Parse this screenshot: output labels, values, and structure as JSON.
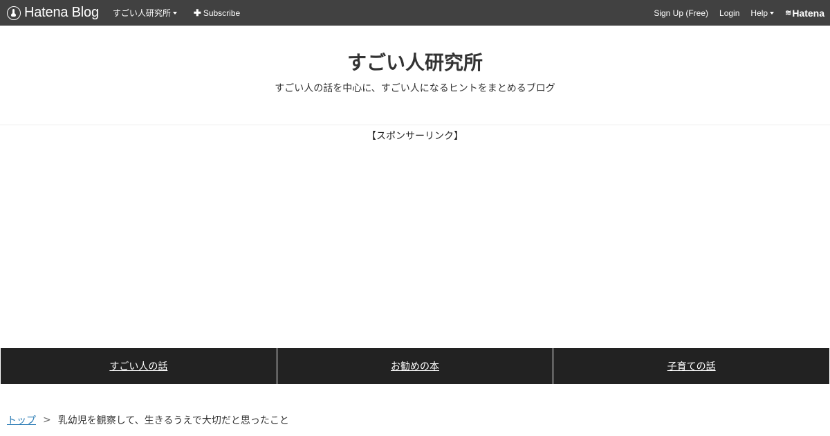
{
  "topbar": {
    "logo_text": "Hatena Blog",
    "blog_menu": "すごい人研究所",
    "subscribe": "Subscribe",
    "signup": "Sign Up (Free)",
    "login": "Login",
    "help": "Help",
    "brand": "Hatena"
  },
  "header": {
    "title": "すごい人研究所",
    "description": "すごい人の話を中心に、すごい人になるヒントをまとめるブログ"
  },
  "sponsor_label": "【スポンサーリンク】",
  "categories": [
    {
      "label": "すごい人の話"
    },
    {
      "label": "お勧めの本"
    },
    {
      "label": "子育ての話"
    }
  ],
  "breadcrumb": {
    "home": "トップ",
    "separator": ">",
    "current": "乳幼児を観察して、生きるうえで大切だと思ったこと"
  },
  "colors": {
    "topbar_bg": "#414141",
    "category_bg": "#222222",
    "link": "#2a7bb5"
  }
}
